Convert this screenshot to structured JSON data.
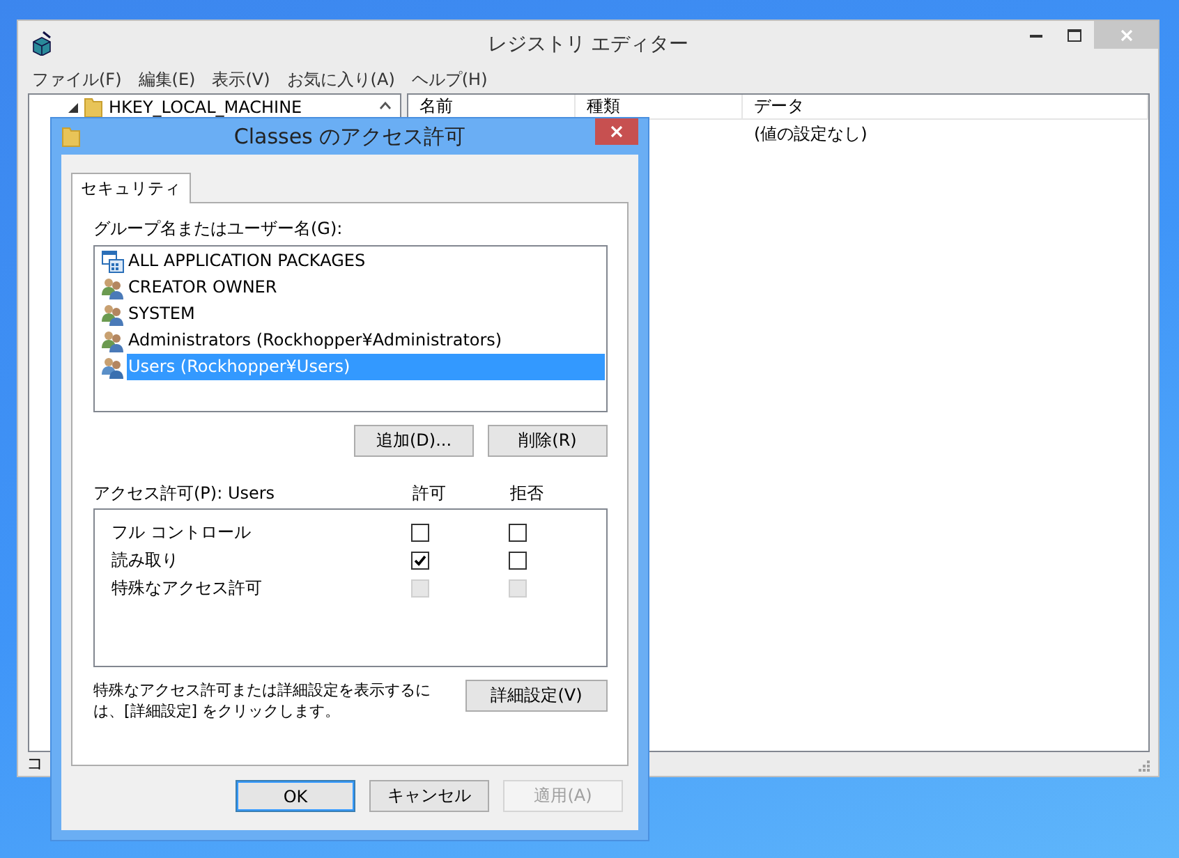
{
  "registry_window": {
    "title": "レジストリ エディター",
    "menu": [
      "ファイル(F)",
      "編集(E)",
      "表示(V)",
      "お気に入り(A)",
      "ヘルプ(H)"
    ],
    "tree": {
      "items": [
        {
          "label": "HKEY_LOCAL_MACHINE",
          "expanded": true
        }
      ]
    },
    "list": {
      "columns": [
        "名前",
        "種類",
        "データ"
      ],
      "rows": [
        {
          "data": "(値の設定なし)"
        }
      ]
    },
    "status_bar": "コ"
  },
  "dialog": {
    "title": "Classes のアクセス許可",
    "tabs": [
      {
        "label": "セキュリティ",
        "selected": true
      }
    ],
    "principals_label": "グループ名またはユーザー名(G):",
    "principals": [
      {
        "name": "ALL APPLICATION PACKAGES",
        "kind": "package",
        "selected": false
      },
      {
        "name": "CREATOR OWNER",
        "kind": "group",
        "selected": false
      },
      {
        "name": "SYSTEM",
        "kind": "group",
        "selected": false
      },
      {
        "name": "Administrators (Rockhopper¥Administrators)",
        "kind": "group",
        "selected": false
      },
      {
        "name": "Users (Rockhopper¥Users)",
        "kind": "users",
        "selected": true
      }
    ],
    "principal_buttons": [
      "追加(D)...",
      "削除(R)"
    ],
    "permissions_label": "アクセス許可(P): Users",
    "permission_columns": [
      "許可",
      "拒否"
    ],
    "permissions": [
      {
        "name": "フル コントロール",
        "allow": {
          "checked": false,
          "disabled": false
        },
        "deny": {
          "checked": false,
          "disabled": false
        }
      },
      {
        "name": "読み取り",
        "allow": {
          "checked": true,
          "disabled": false
        },
        "deny": {
          "checked": false,
          "disabled": false
        }
      },
      {
        "name": "特殊なアクセス許可",
        "allow": {
          "checked": false,
          "disabled": true
        },
        "deny": {
          "checked": false,
          "disabled": true
        }
      }
    ],
    "hint": "特殊なアクセス許可または詳細設定を表示するには、[詳細設定] をクリックします。",
    "advanced_button": "詳細設定(V)",
    "footer_buttons": [
      {
        "label": "OK",
        "default": true,
        "disabled": false
      },
      {
        "label": "キャンセル",
        "default": false,
        "disabled": false
      },
      {
        "label": "適用(A)",
        "default": false,
        "disabled": true
      }
    ]
  }
}
